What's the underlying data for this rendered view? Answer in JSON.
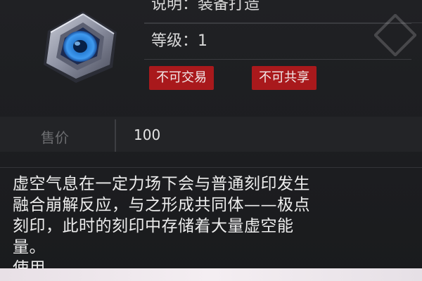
{
  "item": {
    "icon": "void-core-device-icon",
    "properties": {
      "description_line": "说明：装备打造",
      "level_line": "等级：1"
    },
    "tags": [
      "不可交易",
      "不可共享"
    ],
    "price": {
      "label": "售价",
      "value": "100"
    },
    "description_lines": [
      "虚空气息在一定力场下会与普通刻印发生",
      "融合崩解反应，与之形成共同体——极点",
      "刻印，此时的刻印中存储着大量虚空能",
      "量。",
      "使用"
    ]
  },
  "colors": {
    "tag_background": "#a9191c",
    "panel_background": "#1c1d20",
    "icon_core": "#2a7fd6"
  }
}
